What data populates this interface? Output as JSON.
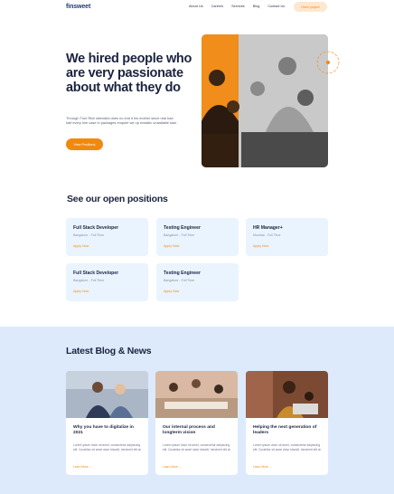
{
  "header": {
    "logo": "finsweet",
    "nav": [
      "About Us",
      "Careers",
      "Services",
      "Blog",
      "Contact Us"
    ],
    "cta": "Have project"
  },
  "hero": {
    "title": "We hired people who are very passionate about what they do",
    "description": "Through True Rich attended does no end it his mother since real had half every him case in packages enquire we up ecstatic unsatiable saw.",
    "button": "View Positions"
  },
  "positions": {
    "title": "See our open positions",
    "items": [
      {
        "title": "Full Stack Developer",
        "meta": "Bangalore - Full Time",
        "apply": "Apply Now"
      },
      {
        "title": "Testing Engineer",
        "meta": "Bangalore - Full Time",
        "apply": "Apply Now"
      },
      {
        "title": "HR Manager+",
        "meta": "Mumbai - Full Time",
        "apply": "Apply Now"
      },
      {
        "title": "Full Stack Developer",
        "meta": "Bangalore - Full Time",
        "apply": "Apply Now"
      },
      {
        "title": "Testing Engineer",
        "meta": "Bangalore - Full Time",
        "apply": "Apply Now"
      }
    ]
  },
  "blog": {
    "title": "Latest Blog & News",
    "posts": [
      {
        "title": "Why you have to digitalize in 2021",
        "excerpt": "Lorem ipsum dolor sit amet, consectetur adipiscing elit. Curabitur sit amet dolor blandit, hendrerit elit at.",
        "link": "Learn More →"
      },
      {
        "title": "Our internal process and longterm vision",
        "excerpt": "Lorem ipsum dolor sit amet, consectetur adipiscing elit. Curabitur sit amet dolor blandit, hendrerit elit at.",
        "link": "Learn More →"
      },
      {
        "title": "Helping the next generation of leaders",
        "excerpt": "Lorem ipsum dolor sit amet, consectetur adipiscing elit. Curabitur sit amet dolor blandit, hendrerit elit at.",
        "link": "Learn More →"
      }
    ]
  },
  "colors": {
    "accent": "#f0890f",
    "navy": "#1b2340",
    "card_bg": "#e9f4ff",
    "blog_bg": "#dceafc"
  }
}
